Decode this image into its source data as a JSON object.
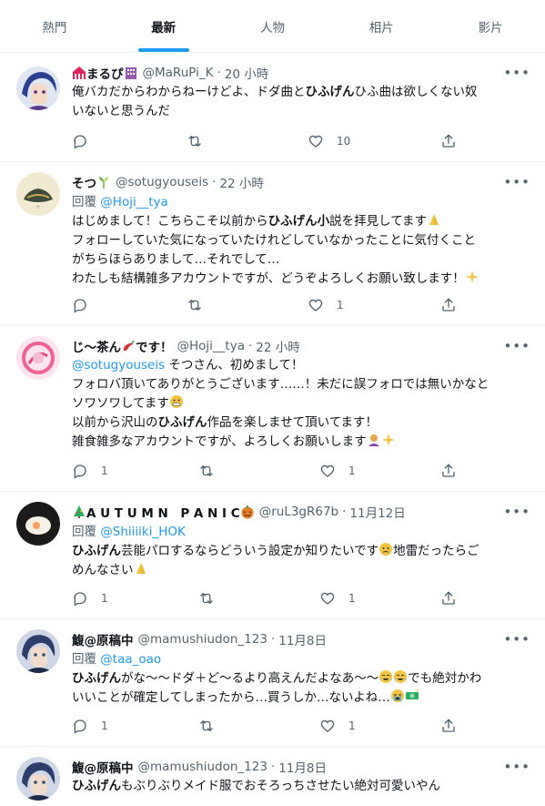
{
  "tabs": [
    {
      "label": "熱門",
      "active": false
    },
    {
      "label": "最新",
      "active": true
    },
    {
      "label": "人物",
      "active": false
    },
    {
      "label": "相片",
      "active": false
    },
    {
      "label": "影片",
      "active": false
    }
  ],
  "tweets": [
    {
      "name": "まるぴ",
      "handle": "@MaRuPi_K",
      "time": "20 小時",
      "reply_to": "",
      "text_lines": [
        [
          {
            "t": "俺バカだからわからねーけどよ、ドダ曲と"
          },
          {
            "t": "ひふげん",
            "b": true
          },
          {
            "t": "ひふ曲は欲しくない奴"
          }
        ],
        [
          {
            "t": "いないと思うんだ"
          }
        ]
      ],
      "reply_count": "",
      "retweet_count": "",
      "like_count": "10",
      "accent": "#3b5998"
    },
    {
      "name": "そつ",
      "handle": "@sotugyouseis",
      "time": "22 小時",
      "reply_label": "回覆",
      "reply_to": "@Hoji__tya",
      "text_lines": [
        [
          {
            "t": "はじめまして！こちらこそ以前から"
          },
          {
            "t": "ひふげん小",
            "b": true
          },
          {
            "t": "説を拝見してます"
          }
        ],
        [
          {
            "t": "フォローしていた気になっていたけれどしていなかったことに気付くこと"
          }
        ],
        [
          {
            "t": "がちらほらありまして…それでして…"
          }
        ],
        [
          {
            "t": "わたしも結構雑多アカウントですが、どうぞよろしくお願い致します！"
          }
        ]
      ],
      "reply_count": "",
      "retweet_count": "",
      "like_count": "1",
      "accent": "#e8d9a0"
    },
    {
      "name": "じ〜茶ん",
      "name_suffix": "です！",
      "handle": "@Hoji__tya",
      "time": "22 小時",
      "reply_to": "",
      "mention_lead": "@sotugyouseis",
      "text_lines": [
        [
          {
            "t": "そつさん、初めまして！"
          }
        ],
        [
          {
            "t": "フォロバ頂いてありがとうございます……！未だに誤フォロでは無いかなと"
          }
        ],
        [
          {
            "t": "ソワソワしてます"
          }
        ],
        [
          {
            "t": "以前から沢山の"
          },
          {
            "t": "ひふげん",
            "b": true
          },
          {
            "t": "作品を楽しませて頂いてます！"
          }
        ],
        [
          {
            "t": "雑食雑多なアカウントですが、よろしくお願いします"
          }
        ]
      ],
      "reply_count": "1",
      "retweet_count": "",
      "like_count": "1",
      "accent": "#f06292"
    },
    {
      "name": "A U T U M N　P A N I C",
      "handle": "@ruL3gR67b",
      "time": "11月12日",
      "reply_label": "回覆",
      "reply_to": "@Shiiiiki_HOK",
      "text_lines": [
        [
          {
            "t": "ひふげん",
            "b": true
          },
          {
            "t": "芸能パロするならどういう設定か知りたいです"
          },
          {
            "t": "地雷だったらご"
          }
        ],
        [
          {
            "t": "めんなさい"
          }
        ]
      ],
      "reply_count": "1",
      "retweet_count": "",
      "like_count": "1",
      "accent": "#222222"
    },
    {
      "name": "鰒@原稿中",
      "handle": "@mamushiudon_123",
      "time": "11月8日",
      "reply_label": "回覆",
      "reply_to": "@taa_oao",
      "text_lines": [
        [
          {
            "t": "ひふげん",
            "b": true
          },
          {
            "t": "がな～～ドダ＋ど～るより高えんだよなあ～～"
          },
          {
            "t": "でも絶対かわ"
          }
        ],
        [
          {
            "t": "いいことが確定してしまったから…買うしか…ないよね…"
          }
        ]
      ],
      "reply_count": "1",
      "retweet_count": "",
      "like_count": "1",
      "accent": "#2c3e6b"
    },
    {
      "name": "鰒@原稿中",
      "handle": "@mamushiudon_123",
      "time": "11月8日",
      "reply_to": "",
      "text_lines": [
        [
          {
            "t": "ひふげん",
            "b": true
          },
          {
            "t": "もぶりぶりメイド服でおそろっちさせたい絶対可愛いやん"
          }
        ]
      ],
      "reply_count": "",
      "retweet_count": "",
      "like_count": "",
      "accent": "#2c3e6b"
    }
  ]
}
